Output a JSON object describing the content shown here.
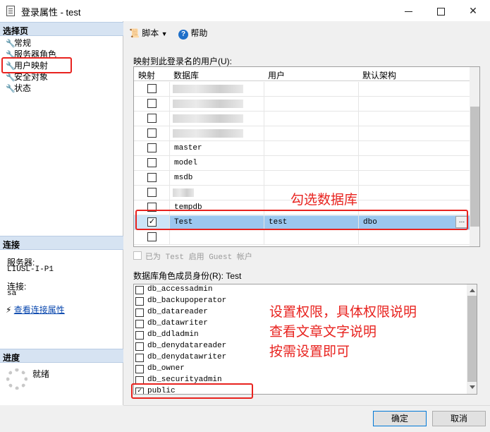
{
  "window": {
    "title": "登录属性 - test"
  },
  "left": {
    "select_page_header": "选择页",
    "pages": [
      "常规",
      "服务器角色",
      "用户映射",
      "安全对象",
      "状态"
    ],
    "connection_header": "连接",
    "server_label": "服务器:",
    "server_value": "LIUSL-I-P1",
    "connection_label": "连接:",
    "connection_value": "sa",
    "view_connection_link": "查看连接属性",
    "progress_header": "进度",
    "progress_status": "就绪"
  },
  "toolbar": {
    "script_label": "脚本",
    "help_label": "帮助"
  },
  "users_mapped": {
    "label": "映射到此登录名的用户(U):",
    "columns": [
      "映射",
      "数据库",
      "用户",
      "默认架构"
    ],
    "rows": [
      {
        "map": false,
        "db": "",
        "user": "",
        "schema": "",
        "blurred": true
      },
      {
        "map": false,
        "db": "",
        "user": "",
        "schema": "",
        "blurred": true
      },
      {
        "map": false,
        "db": "",
        "user": "",
        "schema": "",
        "blurred": true
      },
      {
        "map": false,
        "db": "",
        "user": "",
        "schema": "",
        "blurred": true
      },
      {
        "map": false,
        "db": "master",
        "user": "",
        "schema": ""
      },
      {
        "map": false,
        "db": "model",
        "user": "",
        "schema": ""
      },
      {
        "map": false,
        "db": "msdb",
        "user": "",
        "schema": ""
      },
      {
        "map": false,
        "db": "",
        "user": "",
        "schema": "",
        "blurred": true
      },
      {
        "map": false,
        "db": "tempdb",
        "user": "",
        "schema": ""
      },
      {
        "map": true,
        "db": "Test",
        "user": "test",
        "schema": "dbo"
      },
      {
        "map": false,
        "db": "",
        "user": "",
        "schema": ""
      }
    ],
    "ellipsis": "..."
  },
  "guest": {
    "label": "已为 Test 启用 Guest 帐户"
  },
  "roles": {
    "label": "数据库角色成员身份(R): Test",
    "items": [
      {
        "name": "db_accessadmin",
        "checked": false
      },
      {
        "name": "db_backupoperator",
        "checked": false
      },
      {
        "name": "db_datareader",
        "checked": false
      },
      {
        "name": "db_datawriter",
        "checked": false
      },
      {
        "name": "db_ddladmin",
        "checked": false
      },
      {
        "name": "db_denydatareader",
        "checked": false
      },
      {
        "name": "db_denydatawriter",
        "checked": false
      },
      {
        "name": "db_owner",
        "checked": false
      },
      {
        "name": "db_securityadmin",
        "checked": false
      },
      {
        "name": "public",
        "checked": true
      }
    ]
  },
  "annotations": {
    "select_db": "勾选数据库",
    "perm_line1": "设置权限，具体权限说明",
    "perm_line2": "查看文章文字说明",
    "perm_line3": "按需设置即可"
  },
  "buttons": {
    "ok": "确定",
    "cancel": "取消"
  }
}
